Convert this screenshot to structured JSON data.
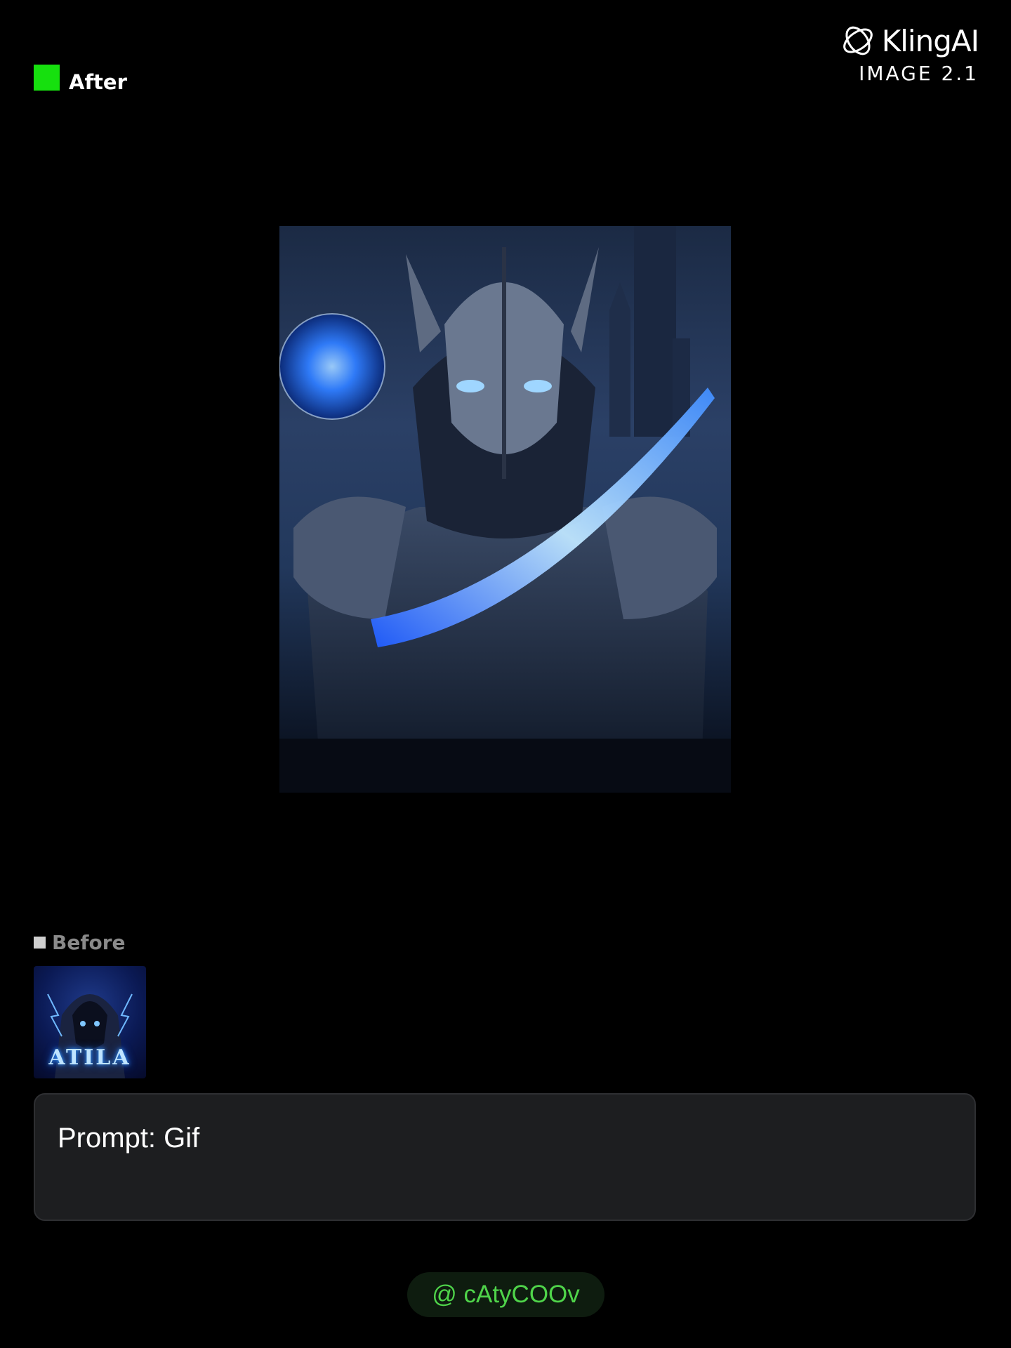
{
  "header": {
    "after_label": "After",
    "after_color": "#16e00e"
  },
  "brand": {
    "name": "KlingAI",
    "subtitle": "IMAGE 2.1",
    "logo_icon": "kling-logo-icon"
  },
  "main_image": {
    "description_icon": "armored-knight-image"
  },
  "before": {
    "label": "Before",
    "thumbnail_text": "ATILA"
  },
  "prompt": {
    "text": "Prompt: Gif"
  },
  "credit": {
    "text": "@ cAtyCOOv",
    "color": "#4fd44a"
  }
}
